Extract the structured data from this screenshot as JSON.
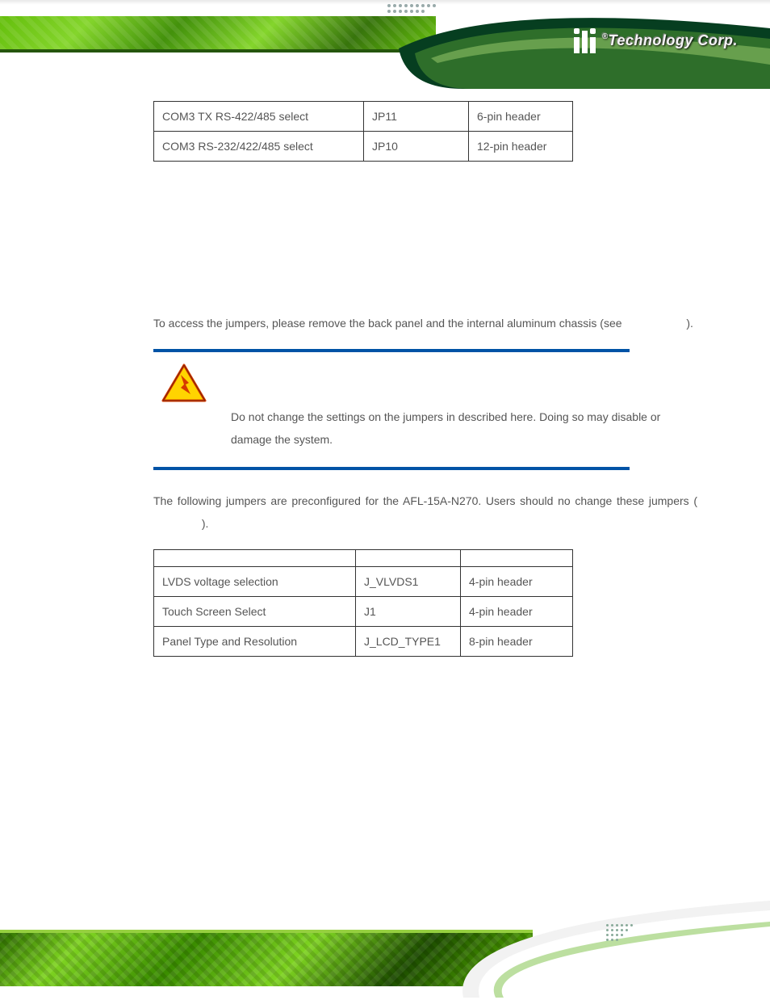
{
  "brand": {
    "reg": "®",
    "text": "Technology Corp."
  },
  "table1": {
    "rows": [
      {
        "desc": "COM3 TX RS-422/485 select",
        "label": "JP11",
        "type": "6-pin header"
      },
      {
        "desc": "COM3 RS-232/422/485 select",
        "label": "JP10",
        "type": "12-pin header"
      }
    ]
  },
  "caption1": "",
  "subheading": "",
  "para1_a": "To access the jumpers, please remove the back panel and the internal aluminum chassis (see ",
  "para1_b": ").",
  "warning": "Do not change the settings on the jumpers in described here. Doing so may disable or damage the system.",
  "para2_a": "The following jumpers are preconfigured for the AFL-15A-N270. Users should no change these jumpers (",
  "para2_b": ").",
  "table2": {
    "headers": [
      "",
      "",
      ""
    ],
    "rows": [
      {
        "desc": "LVDS voltage selection",
        "label": "J_VLVDS1",
        "type": "4-pin header"
      },
      {
        "desc": "Touch Screen Select",
        "label": "J1",
        "type": "4-pin header"
      },
      {
        "desc": "Panel Type and Resolution",
        "label": "J_LCD_TYPE1",
        "type": "8-pin header"
      }
    ]
  },
  "caption2": ""
}
